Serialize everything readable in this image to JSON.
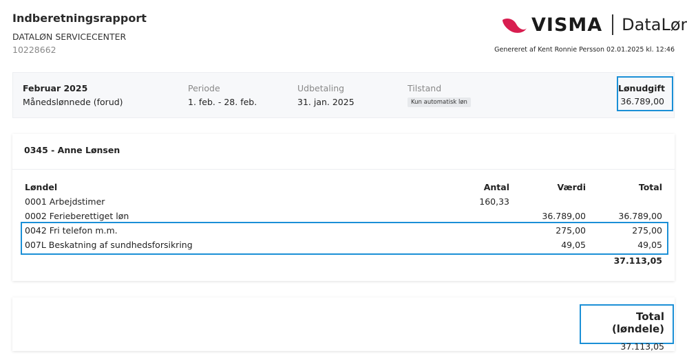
{
  "header": {
    "title": "Indberetningsrapport",
    "company": "DATALØN SERVICECENTER",
    "company_id": "10228662",
    "generated": "Genereret af Kent Ronnie Persson 02.01.2025 kl. 12:46"
  },
  "logo": {
    "visma": "VISMA",
    "product": "DataLøn",
    "brand_color": "#d81e50"
  },
  "summary": {
    "month": "Februar 2025",
    "pay_type": "Månedslønnede (forud)",
    "period_label": "Periode",
    "period_value": "1. feb. - 28. feb.",
    "payout_label": "Udbetaling",
    "payout_value": "31. jan. 2025",
    "status_label": "Tilstand",
    "status_badge": "Kun automatisk løn",
    "cost_label": "Lønudgift",
    "cost_value": "36.789,00"
  },
  "employee": {
    "name": "0345 - Anne Lønsen",
    "columns": {
      "name": "Løndel",
      "antal": "Antal",
      "vaerdi": "Værdi",
      "total": "Total"
    },
    "rows": [
      {
        "name": "0001 Arbejdstimer",
        "antal": "160,33",
        "vaerdi": "",
        "total": ""
      },
      {
        "name": "0002 Ferieberettiget løn",
        "antal": "",
        "vaerdi": "36.789,00",
        "total": "36.789,00"
      },
      {
        "name": "0042 Fri telefon m.m.",
        "antal": "",
        "vaerdi": "275,00",
        "total": "275,00"
      },
      {
        "name": "007L Beskatning af sundhedsforsikring",
        "antal": "",
        "vaerdi": "49,05",
        "total": "49,05"
      }
    ],
    "subtotal": "37.113,05"
  },
  "grand_total": {
    "label": "Total (løndele)",
    "value": "37.113,05"
  },
  "colors": {
    "highlight": "#1a8fd6"
  }
}
